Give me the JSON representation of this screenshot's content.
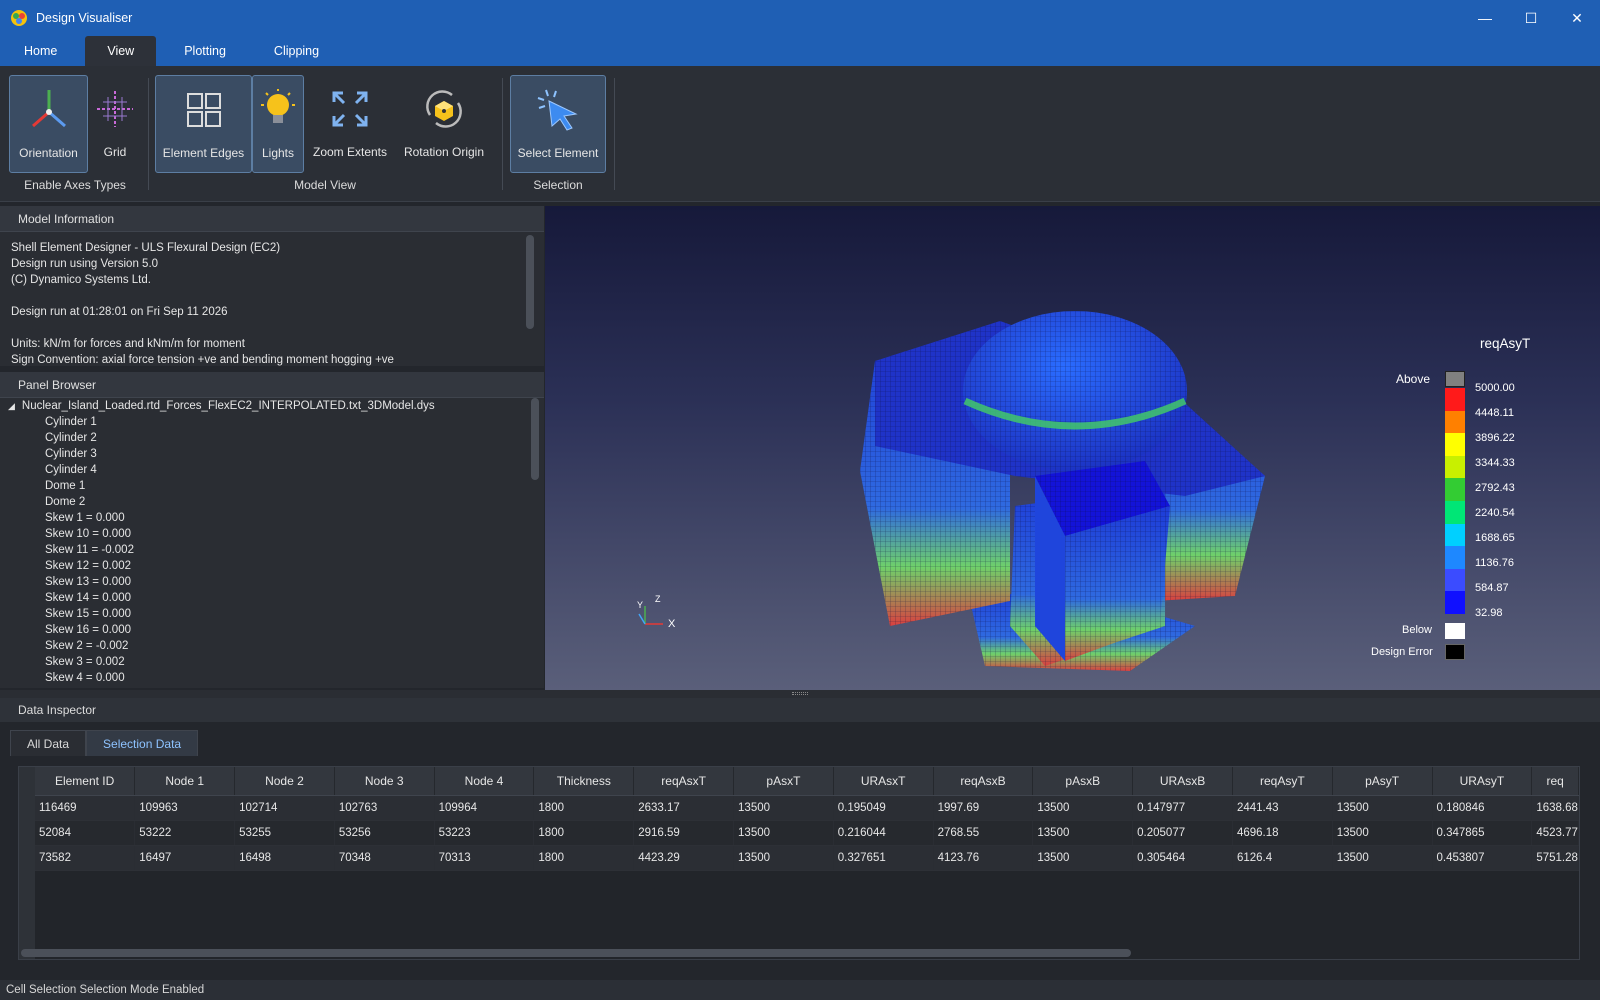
{
  "window": {
    "title": "Design Visualiser"
  },
  "menu_tabs": [
    "Home",
    "View",
    "Plotting",
    "Clipping"
  ],
  "ribbon": {
    "buttons": {
      "orientation": "Orientation",
      "grid": "Grid",
      "element_edges": "Element Edges",
      "lights": "Lights",
      "zoom_extents": "Zoom Extents",
      "rotation_origin": "Rotation Origin",
      "select_element": "Select Element"
    },
    "groups": {
      "axes": "Enable Axes Types",
      "model_view": "Model View",
      "selection": "Selection"
    }
  },
  "model_info": {
    "header": "Model Information",
    "lines": [
      "Shell Element Designer - ULS Flexural Design (EC2)",
      "Design run using Version 5.0",
      "(C) Dynamico Systems Ltd.",
      "",
      "Design run at 01:28:01 on Fri Sep 11 2026",
      "",
      "Units: kN/m for forces and kNm/m for moment",
      "Sign Convention: axial force tension +ve and bending moment hogging +ve"
    ]
  },
  "panel_browser": {
    "header": "Panel Browser",
    "root": "Nuclear_Island_Loaded.rtd_Forces_FlexEC2_INTERPOLATED.txt_3DModel.dys",
    "items": [
      "Cylinder 1",
      "Cylinder 2",
      "Cylinder 3",
      "Cylinder 4",
      "Dome 1",
      "Dome 2",
      "Skew 1 = 0.000",
      "Skew 10 = 0.000",
      "Skew 11 = -0.002",
      "Skew 12 = 0.002",
      "Skew 13 = 0.000",
      "Skew 14 = 0.000",
      "Skew 15 = 0.000",
      "Skew 16 = 0.000",
      "Skew 2 = -0.002",
      "Skew 3 = 0.002",
      "Skew 4 = 0.000"
    ]
  },
  "legend": {
    "title": "reqAsyT",
    "above_label": "Above",
    "below_label": "Below",
    "error_label": "Design Error",
    "values": [
      "5000.00",
      "4448.11",
      "3896.22",
      "3344.33",
      "2792.43",
      "2240.54",
      "1688.65",
      "1136.76",
      "584.87",
      "32.98"
    ],
    "colors": [
      "#ff1a1a",
      "#ff8000",
      "#ffff00",
      "#c8f000",
      "#33cc33",
      "#00e676",
      "#00d0ff",
      "#1e88ff",
      "#3b4cff",
      "#1010ff"
    ],
    "above_color": "#808080",
    "below_color": "#ffffff",
    "error_color": "#000000"
  },
  "axis_triad": {
    "x": "X",
    "y": "Y",
    "z": "Z"
  },
  "inspector": {
    "header": "Data Inspector",
    "tabs": [
      "All Data",
      "Selection Data"
    ],
    "columns": [
      "Element ID",
      "Node 1",
      "Node 2",
      "Node 3",
      "Node 4",
      "Thickness",
      "reqAsxT",
      "pAsxT",
      "URAsxT",
      "reqAsxB",
      "pAsxB",
      "URAsxB",
      "reqAsyT",
      "pAsyT",
      "URAsyT",
      "req"
    ],
    "rows": [
      [
        "116469",
        "109963",
        "102714",
        "102763",
        "109964",
        "1800",
        "2633.17",
        "13500",
        "0.195049",
        "1997.69",
        "13500",
        "0.147977",
        "2441.43",
        "13500",
        "0.180846",
        "1638.68"
      ],
      [
        "52084",
        "53222",
        "53255",
        "53256",
        "53223",
        "1800",
        "2916.59",
        "13500",
        "0.216044",
        "2768.55",
        "13500",
        "0.205077",
        "4696.18",
        "13500",
        "0.347865",
        "4523.77"
      ],
      [
        "73582",
        "16497",
        "16498",
        "70348",
        "70313",
        "1800",
        "4423.29",
        "13500",
        "0.327651",
        "4123.76",
        "13500",
        "0.305464",
        "6126.4",
        "13500",
        "0.453807",
        "5751.28"
      ]
    ]
  },
  "status": "Cell Selection Selection Mode Enabled"
}
